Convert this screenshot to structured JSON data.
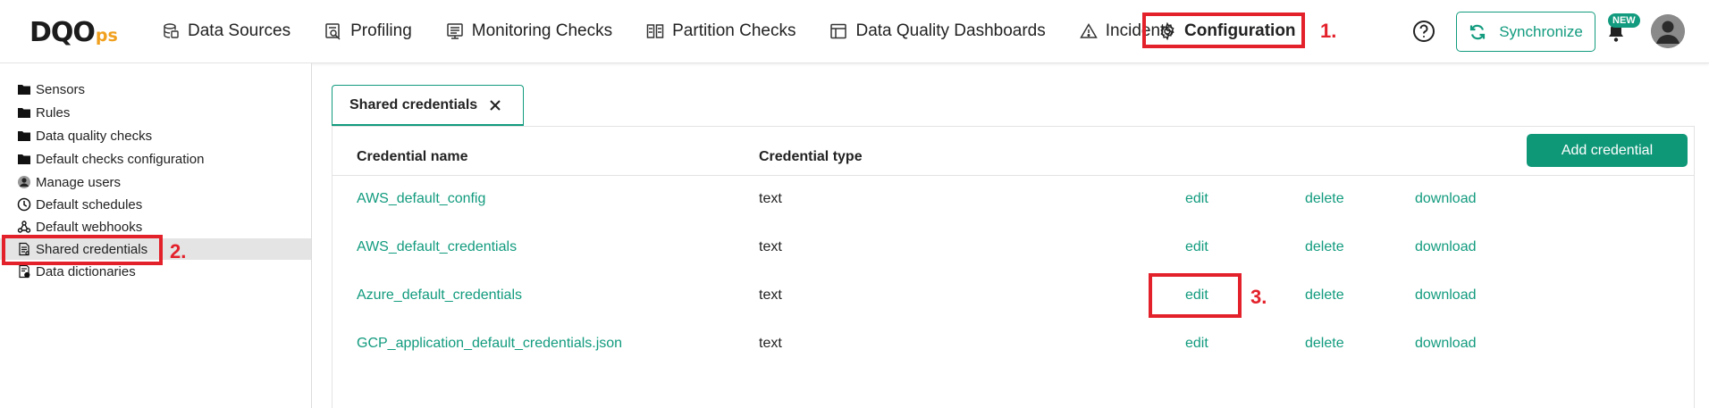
{
  "header": {
    "logo_main": "DQO",
    "logo_sub": "ps",
    "nav": [
      {
        "label": "Data Sources",
        "icon": "database-icon"
      },
      {
        "label": "Profiling",
        "icon": "profiling-icon"
      },
      {
        "label": "Monitoring Checks",
        "icon": "monitoring-icon"
      },
      {
        "label": "Partition Checks",
        "icon": "partition-icon"
      },
      {
        "label": "Data Quality Dashboards",
        "icon": "dashboard-icon"
      },
      {
        "label": "Incidents",
        "icon": "warning-icon"
      },
      {
        "label": "Configuration",
        "icon": "gear-icon"
      }
    ],
    "sync_label": "Synchronize",
    "new_badge": "NEW"
  },
  "sidebar": {
    "items": [
      {
        "label": "Sensors",
        "icon": "folder-icon"
      },
      {
        "label": "Rules",
        "icon": "folder-icon"
      },
      {
        "label": "Data quality checks",
        "icon": "folder-icon"
      },
      {
        "label": "Default checks configuration",
        "icon": "folder-icon"
      },
      {
        "label": "Manage users",
        "icon": "user-icon"
      },
      {
        "label": "Default schedules",
        "icon": "clock-icon"
      },
      {
        "label": "Default webhooks",
        "icon": "webhook-icon"
      },
      {
        "label": "Shared credentials",
        "icon": "credentials-icon"
      },
      {
        "label": "Data dictionaries",
        "icon": "dictionary-icon"
      }
    ],
    "selected": "Shared credentials"
  },
  "tab": {
    "label": "Shared credentials"
  },
  "table": {
    "columns": [
      "Credential name",
      "Credential type"
    ],
    "add_label": "Add credential",
    "actions": [
      "edit",
      "delete",
      "download"
    ],
    "rows": [
      {
        "name": "AWS_default_config",
        "type": "text"
      },
      {
        "name": "AWS_default_credentials",
        "type": "text"
      },
      {
        "name": "Azure_default_credentials",
        "type": "text"
      },
      {
        "name": "GCP_application_default_credentials.json",
        "type": "text"
      }
    ]
  },
  "annotations": [
    "1.",
    "2.",
    "3."
  ],
  "colors": {
    "accent": "#129b7e",
    "highlight": "#e3212b",
    "logo_accent": "#f0a01e"
  }
}
